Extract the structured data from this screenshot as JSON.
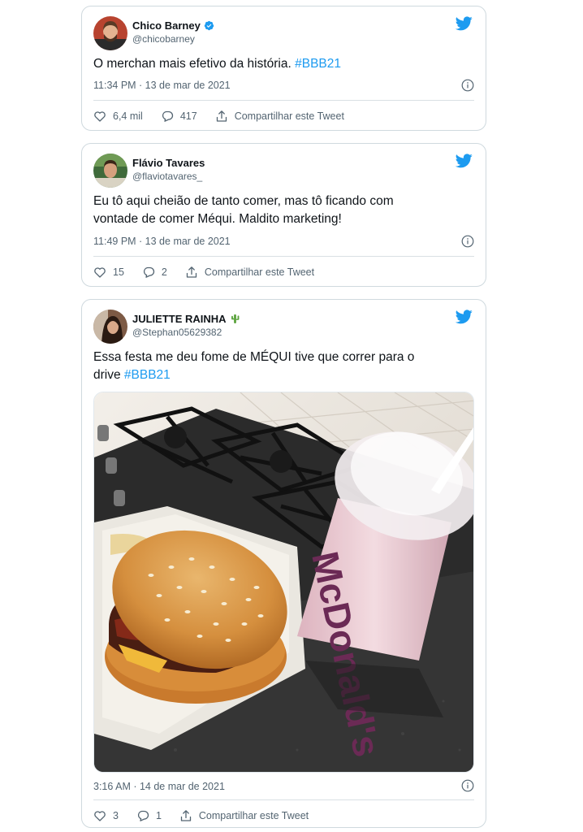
{
  "colors": {
    "accent": "#1d9bf0",
    "text": "#0f1419",
    "muted": "#536471",
    "border": "#cfd9de"
  },
  "tweets": [
    {
      "name": "Chico Barney",
      "verified": true,
      "handle": "@chicobarney",
      "text": "O merchan mais efetivo da história. ",
      "hashtag": "#BBB21",
      "time": "11:34 PM · 13 de mar de 2021",
      "likes": "6,4 mil",
      "replies": "417",
      "share": "Compartilhar este Tweet"
    },
    {
      "name": "Flávio Tavares",
      "verified": false,
      "handle": "@flaviotavares_",
      "text_line1": "Eu tô aqui cheião de tanto comer, mas tô ficando com",
      "text_line2": "vontade de comer Méqui. Maldito marketing!",
      "time": "11:49 PM · 13 de mar de 2021",
      "likes": "15",
      "replies": "2",
      "share": "Compartilhar este Tweet"
    },
    {
      "name": "JULIETTE RAINHA",
      "name_emoji": "cactus-icon",
      "handle": "@Stephan05629382",
      "text_line1": "Essa festa me deu fome de MÉQUI tive que correr para o",
      "text_line2": "drive ",
      "hashtag": "#BBB21",
      "photo_cup_text": "McDonald's",
      "time": "3:16 AM · 14 de mar de 2021",
      "likes": "3",
      "replies": "1",
      "share": "Compartilhar este Tweet"
    }
  ]
}
